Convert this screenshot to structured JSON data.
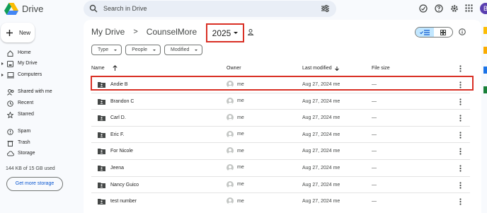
{
  "app": {
    "name": "Drive"
  },
  "search": {
    "placeholder": "Search in Drive"
  },
  "account": {
    "initial": "B"
  },
  "sidebar": {
    "new_label": "New",
    "items": [
      {
        "label": "Home",
        "icon": "home-icon"
      },
      {
        "label": "My Drive",
        "icon": "my-drive-icon"
      },
      {
        "label": "Computers",
        "icon": "computers-icon"
      },
      {
        "label": "Shared with me",
        "icon": "shared-icon"
      },
      {
        "label": "Recent",
        "icon": "clock-icon"
      },
      {
        "label": "Starred",
        "icon": "star-icon"
      },
      {
        "label": "Spam",
        "icon": "spam-icon"
      },
      {
        "label": "Trash",
        "icon": "trash-icon"
      },
      {
        "label": "Storage",
        "icon": "cloud-icon"
      }
    ],
    "storage_text": "144 KB of 15 GB used",
    "storage_button": "Get more storage"
  },
  "breadcrumb": {
    "items": [
      "My Drive",
      "CounselMore",
      "2025"
    ],
    "separator": ">"
  },
  "filters": [
    "Type",
    "People",
    "Modified"
  ],
  "table": {
    "columns": {
      "name": "Name",
      "owner": "Owner",
      "modified": "Last modified",
      "size": "File size"
    },
    "rows": [
      {
        "name": "Andie B",
        "owner": "me",
        "modified": "Aug 27, 2024 me",
        "size": "—"
      },
      {
        "name": "Brandon C",
        "owner": "me",
        "modified": "Aug 27, 2024 me",
        "size": "—"
      },
      {
        "name": "Carl D.",
        "owner": "me",
        "modified": "Aug 27, 2024 me",
        "size": "—"
      },
      {
        "name": "Eric F.",
        "owner": "me",
        "modified": "Aug 27, 2024 me",
        "size": "—"
      },
      {
        "name": "For Nicole",
        "owner": "me",
        "modified": "Aug 27, 2024 me",
        "size": "—"
      },
      {
        "name": "Jeena",
        "owner": "me",
        "modified": "Aug 27, 2024 me",
        "size": "—"
      },
      {
        "name": "Nancy Guico",
        "owner": "me",
        "modified": "Aug 27, 2024 me",
        "size": "—"
      },
      {
        "name": "test number",
        "owner": "me",
        "modified": "Aug 27, 2024 me",
        "size": "—"
      }
    ]
  },
  "colors": {
    "accent": "#0b57d0",
    "highlight": "#d93025",
    "selected_toggle": "#c2e7ff"
  }
}
